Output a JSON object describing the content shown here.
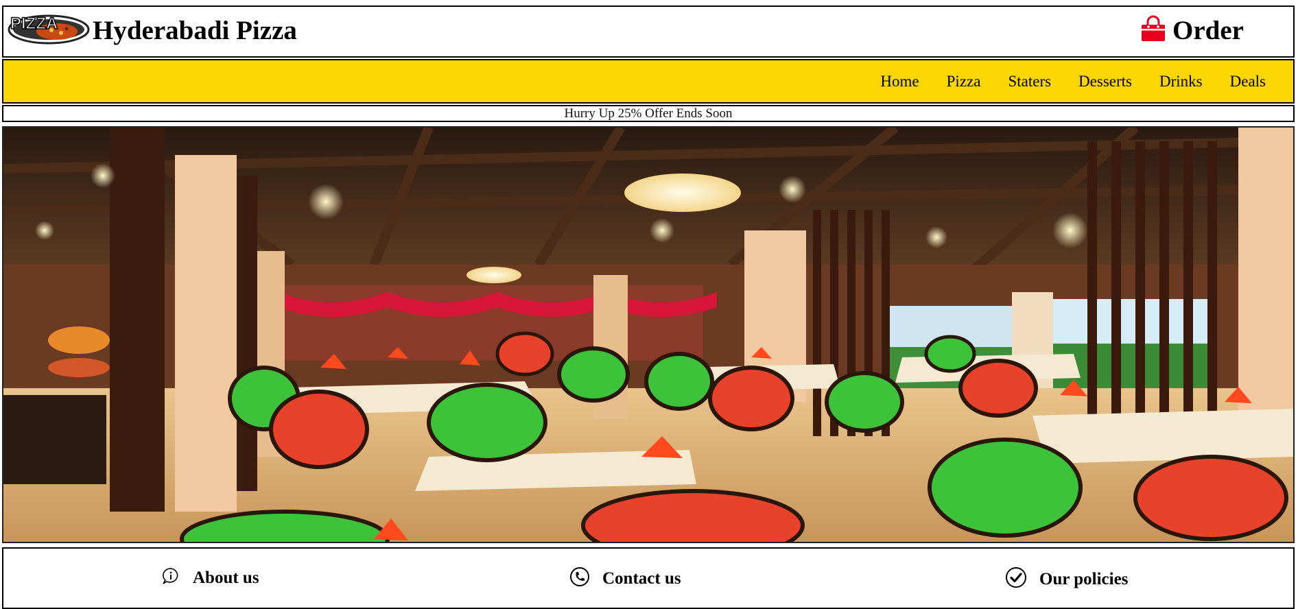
{
  "header": {
    "logo_text": "PIZZA",
    "brand_name": "Hyderabadi Pizza",
    "order_label": "Order",
    "order_icon": "shopping-bag-icon"
  },
  "nav": {
    "items": [
      {
        "label": "Home"
      },
      {
        "label": "Pizza"
      },
      {
        "label": "Staters"
      },
      {
        "label": "Desserts"
      },
      {
        "label": "Drinks"
      },
      {
        "label": "Deals"
      }
    ]
  },
  "offer": {
    "text": "Hurry Up 25% Offer Ends Soon"
  },
  "hero": {
    "image_alt": ""
  },
  "footer": {
    "items": [
      {
        "label": "About us",
        "icon": "info-icon"
      },
      {
        "label": "Contact us",
        "icon": "phone-icon"
      },
      {
        "label": "Our policies",
        "icon": "check-circle-icon"
      }
    ]
  },
  "colors": {
    "nav_background": "#fcd600",
    "order_icon": "#e8001c"
  }
}
